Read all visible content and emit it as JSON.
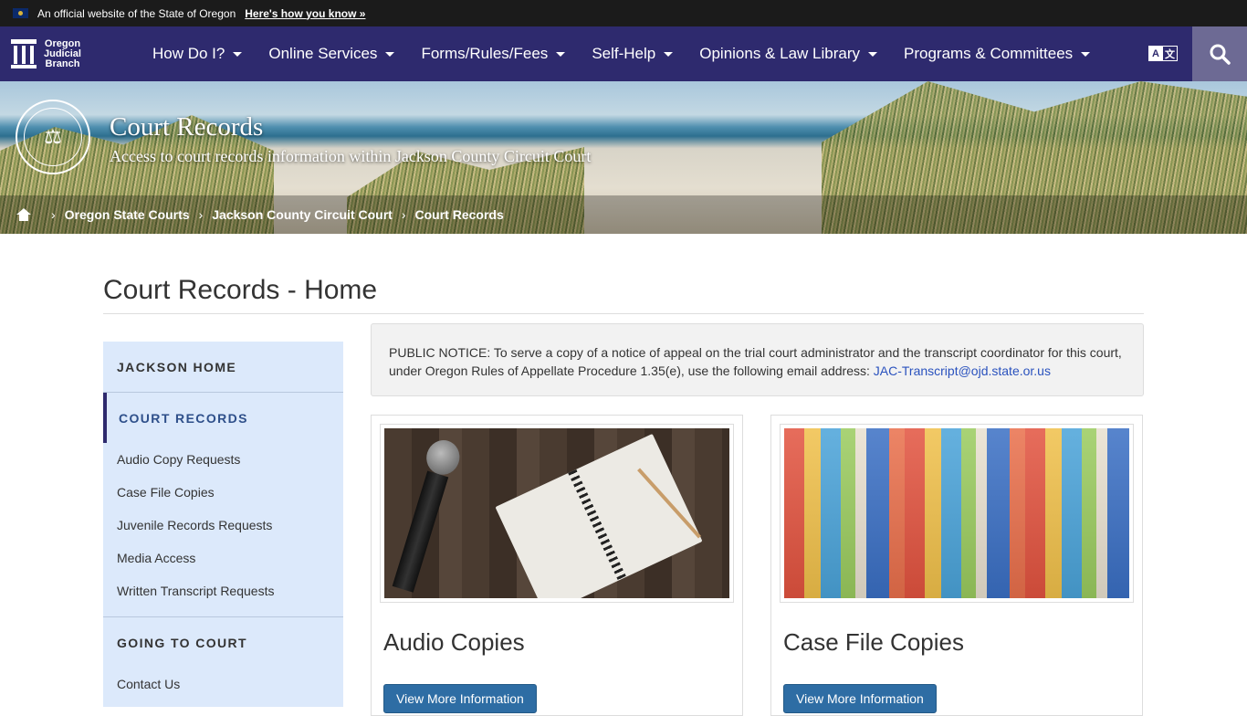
{
  "gov_banner": {
    "text": "An official website of the State of Oregon",
    "link": "Here's how you know »"
  },
  "logo": {
    "line1": "Oregon",
    "line2": "Judicial",
    "line3": "Branch"
  },
  "nav": {
    "items": [
      {
        "label": "How Do I?"
      },
      {
        "label": "Online Services"
      },
      {
        "label": "Forms/Rules/Fees"
      },
      {
        "label": "Self-Help"
      },
      {
        "label": "Opinions & Law Library"
      },
      {
        "label": "Programs & Committees"
      }
    ],
    "translate_a": "A",
    "translate_b": "文"
  },
  "hero": {
    "title": "Court Records",
    "subtitle": "Access to court records information within Jackson County Circuit Court"
  },
  "breadcrumb": [
    "Oregon State Courts",
    "Jackson County Circuit Court",
    "Court Records"
  ],
  "page_title": "Court Records - Home",
  "sidebar": {
    "section1": "JACKSON HOME",
    "section2": "COURT RECORDS",
    "links": [
      "Audio Copy Requests",
      "Case File Copies",
      "Juvenile Records Requests",
      "Media Access",
      "Written Transcript Requests"
    ],
    "section3": "GOING TO COURT",
    "links2": [
      "Contact Us"
    ]
  },
  "notice": {
    "text": "PUBLIC NOTICE: To serve a copy of a notice of appeal on the trial court administrator and the transcript coordinator for this court, under Oregon Rules of Appellate Procedure 1.35(e), use the following email address: ",
    "email": "JAC-Transcript@ojd.state.or.us"
  },
  "cards": [
    {
      "title": "Audio Copies",
      "button": "View More Information"
    },
    {
      "title": "Case File Copies",
      "button": "View More Information"
    }
  ],
  "colors": {
    "nav_bg": "#2e2a6e",
    "sidebar_bg": "#dce9fb",
    "button_bg": "#2e6da4"
  }
}
